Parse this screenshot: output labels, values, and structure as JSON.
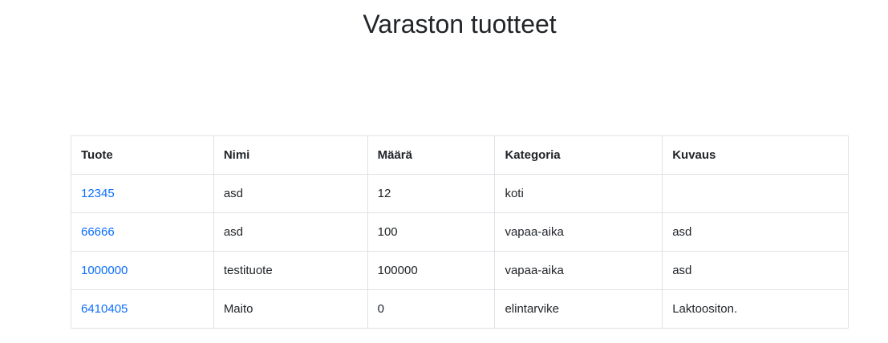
{
  "page": {
    "title": "Varaston tuotteet"
  },
  "table": {
    "headers": [
      "Tuote",
      "Nimi",
      "Määrä",
      "Kategoria",
      "Kuvaus"
    ],
    "rows": [
      {
        "tuote": "12345",
        "nimi": "asd",
        "maara": "12",
        "kategoria": "koti",
        "kuvaus": ""
      },
      {
        "tuote": "66666",
        "nimi": "asd",
        "maara": "100",
        "kategoria": "vapaa-aika",
        "kuvaus": "asd"
      },
      {
        "tuote": "1000000",
        "nimi": "testituote",
        "maara": "100000",
        "kategoria": "vapaa-aika",
        "kuvaus": "asd"
      },
      {
        "tuote": "6410405",
        "nimi": "Maito",
        "maara": "0",
        "kategoria": "elintarvike",
        "kuvaus": "Laktoositon."
      }
    ]
  },
  "colors": {
    "link": "#0d6efd",
    "text": "#212529",
    "border": "#dee2e6"
  }
}
